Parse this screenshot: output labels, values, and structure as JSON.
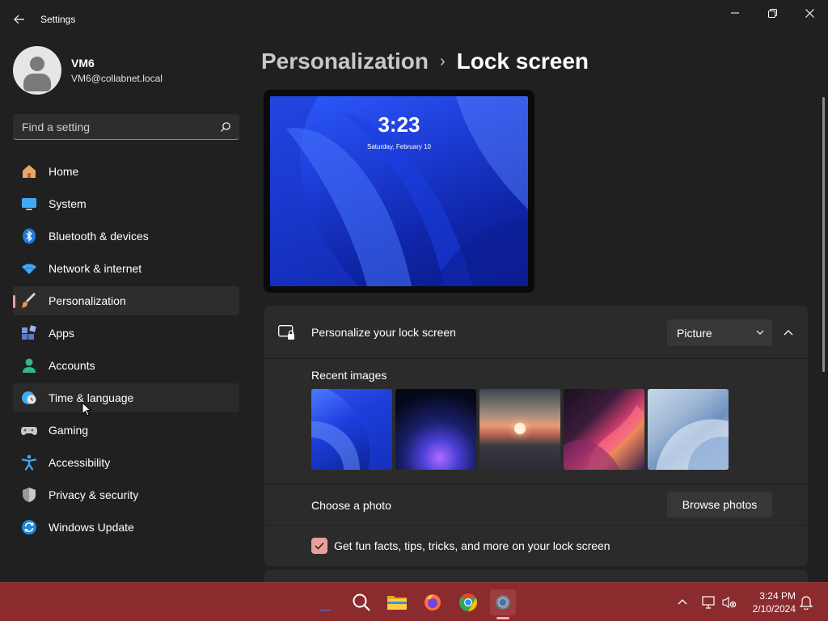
{
  "window": {
    "app_title": "Settings"
  },
  "profile": {
    "name": "VM6",
    "email": "VM6@collabnet.local"
  },
  "search": {
    "placeholder": "Find a setting"
  },
  "nav": {
    "items": [
      {
        "label": "Home",
        "icon": "home-icon"
      },
      {
        "label": "System",
        "icon": "monitor-icon"
      },
      {
        "label": "Bluetooth & devices",
        "icon": "bluetooth-icon"
      },
      {
        "label": "Network & internet",
        "icon": "wifi-icon"
      },
      {
        "label": "Personalization",
        "icon": "paintbrush-icon",
        "selected": true
      },
      {
        "label": "Apps",
        "icon": "apps-icon"
      },
      {
        "label": "Accounts",
        "icon": "person-icon"
      },
      {
        "label": "Time & language",
        "icon": "globe-clock-icon",
        "hovered": true
      },
      {
        "label": "Gaming",
        "icon": "gamepad-icon"
      },
      {
        "label": "Accessibility",
        "icon": "accessibility-icon"
      },
      {
        "label": "Privacy & security",
        "icon": "shield-icon"
      },
      {
        "label": "Windows Update",
        "icon": "update-icon"
      }
    ]
  },
  "breadcrumb": {
    "parent": "Personalization",
    "separator": "›",
    "current": "Lock screen"
  },
  "preview": {
    "time": "3:23",
    "date": "Saturday, February 10"
  },
  "lock_card": {
    "title": "Personalize your lock screen",
    "dropdown_value": "Picture",
    "recent_images_label": "Recent images",
    "recent_images": [
      "blue-bloom",
      "glow-orb",
      "sunset-lake",
      "pink-ribbon",
      "light-bloom"
    ],
    "choose_photo_label": "Choose a photo",
    "browse_button": "Browse photos",
    "fun_facts_label": "Get fun facts, tips, tricks, and more on your lock screen",
    "fun_facts_checked": true
  },
  "taskbar": {
    "time": "3:24 PM",
    "date": "2/10/2024"
  },
  "colors": {
    "accent": "#e8a09a",
    "taskbar": "#8b2b2e",
    "background": "#202020",
    "card": "#2b2b2b"
  }
}
